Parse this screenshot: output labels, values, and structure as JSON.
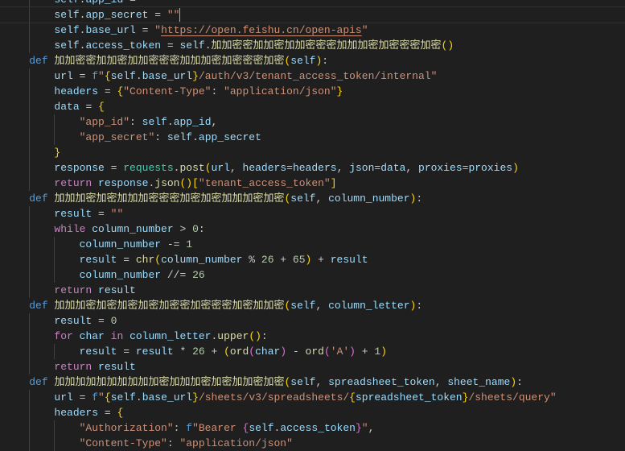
{
  "editor": {
    "language": "python",
    "theme_colors": {
      "background": "#1f1f1f",
      "variable": "#9cdcfe",
      "keyword": "#569cd6",
      "function": "#dcdcaa",
      "string": "#ce9178",
      "control": "#c586c0",
      "number": "#b5cea8",
      "bracket1": "#ffd700",
      "bracket2": "#da70d6",
      "module": "#4ec9b0"
    },
    "current_line": 1,
    "lines": [
      {
        "indent": 2,
        "tokens": [
          [
            "        ",
            "o"
          ],
          [
            "self",
            "v"
          ],
          [
            ".",
            "o"
          ],
          [
            "app_id",
            "v"
          ],
          [
            " = ",
            "o"
          ],
          [
            "\"\"",
            "s"
          ]
        ]
      },
      {
        "indent": 2,
        "tokens": [
          [
            "        ",
            "o"
          ],
          [
            "self",
            "v"
          ],
          [
            ".",
            "o"
          ],
          [
            "app_secret",
            "v"
          ],
          [
            " = ",
            "o"
          ],
          [
            "\"\"",
            "s"
          ]
        ]
      },
      {
        "indent": 2,
        "tokens": [
          [
            "        ",
            "o"
          ],
          [
            "self",
            "v"
          ],
          [
            ".",
            "o"
          ],
          [
            "base_url",
            "v"
          ],
          [
            " = ",
            "o"
          ],
          [
            "\"",
            "s"
          ],
          [
            "https://open.feishu.cn/open-apis",
            "u"
          ],
          [
            "\"",
            "s"
          ]
        ]
      },
      {
        "indent": 2,
        "tokens": [
          [
            "        ",
            "o"
          ],
          [
            "self",
            "v"
          ],
          [
            ".",
            "o"
          ],
          [
            "access_token",
            "v"
          ],
          [
            " = ",
            "o"
          ],
          [
            "self",
            "v"
          ],
          [
            ".",
            "o"
          ],
          [
            "加加密密加加密加加密密密加加加密加密密密加密",
            "f"
          ],
          [
            "()",
            "b1"
          ]
        ]
      },
      {
        "indent": 1,
        "tokens": [
          [
            "    ",
            "o"
          ],
          [
            "def ",
            "k"
          ],
          [
            "加加密密加加密加加密密密加加加密加密密密加密",
            "f"
          ],
          [
            "(",
            "b1"
          ],
          [
            "self",
            "v"
          ],
          [
            ")",
            "b1"
          ],
          [
            ":",
            "o"
          ]
        ]
      },
      {
        "indent": 2,
        "tokens": [
          [
            "        ",
            "o"
          ],
          [
            "url",
            "v"
          ],
          [
            " = ",
            "o"
          ],
          [
            "f",
            "k"
          ],
          [
            "\"",
            "s"
          ],
          [
            "{",
            "b1"
          ],
          [
            "self",
            "v"
          ],
          [
            ".",
            "o"
          ],
          [
            "base_url",
            "v"
          ],
          [
            "}",
            "b1"
          ],
          [
            "/auth/v3/tenant_access_token/internal\"",
            "s"
          ]
        ]
      },
      {
        "indent": 2,
        "tokens": [
          [
            "        ",
            "o"
          ],
          [
            "headers",
            "v"
          ],
          [
            " = ",
            "o"
          ],
          [
            "{",
            "b1"
          ],
          [
            "\"Content-Type\"",
            "s"
          ],
          [
            ": ",
            "o"
          ],
          [
            "\"application/json\"",
            "s"
          ],
          [
            "}",
            "b1"
          ]
        ]
      },
      {
        "indent": 2,
        "tokens": [
          [
            "        ",
            "o"
          ],
          [
            "data",
            "v"
          ],
          [
            " = ",
            "o"
          ],
          [
            "{",
            "b1"
          ]
        ]
      },
      {
        "indent": 3,
        "tokens": [
          [
            "            ",
            "o"
          ],
          [
            "\"app_id\"",
            "s"
          ],
          [
            ": ",
            "o"
          ],
          [
            "self",
            "v"
          ],
          [
            ".",
            "o"
          ],
          [
            "app_id",
            "v"
          ],
          [
            ",",
            "o"
          ]
        ]
      },
      {
        "indent": 3,
        "tokens": [
          [
            "            ",
            "o"
          ],
          [
            "\"app_secret\"",
            "s"
          ],
          [
            ": ",
            "o"
          ],
          [
            "self",
            "v"
          ],
          [
            ".",
            "o"
          ],
          [
            "app_secret",
            "v"
          ]
        ]
      },
      {
        "indent": 2,
        "tokens": [
          [
            "        ",
            "o"
          ],
          [
            "}",
            "b1"
          ]
        ]
      },
      {
        "indent": 2,
        "tokens": [
          [
            "        ",
            "o"
          ],
          [
            "response",
            "v"
          ],
          [
            " = ",
            "o"
          ],
          [
            "requests",
            "m"
          ],
          [
            ".",
            "o"
          ],
          [
            "post",
            "f"
          ],
          [
            "(",
            "b1"
          ],
          [
            "url",
            "v"
          ],
          [
            ", ",
            "o"
          ],
          [
            "headers",
            "v"
          ],
          [
            "=",
            "o"
          ],
          [
            "headers",
            "v"
          ],
          [
            ", ",
            "o"
          ],
          [
            "json",
            "v"
          ],
          [
            "=",
            "o"
          ],
          [
            "data",
            "v"
          ],
          [
            ", ",
            "o"
          ],
          [
            "proxies",
            "v"
          ],
          [
            "=",
            "o"
          ],
          [
            "proxies",
            "v"
          ],
          [
            ")",
            "b1"
          ]
        ]
      },
      {
        "indent": 2,
        "tokens": [
          [
            "        ",
            "o"
          ],
          [
            "return ",
            "c"
          ],
          [
            "response",
            "v"
          ],
          [
            ".",
            "o"
          ],
          [
            "json",
            "f"
          ],
          [
            "()",
            "b1"
          ],
          [
            "[",
            "b1"
          ],
          [
            "\"tenant_access_token\"",
            "s"
          ],
          [
            "]",
            "b1"
          ]
        ]
      },
      {
        "indent": 1,
        "tokens": [
          [
            "    ",
            "o"
          ],
          [
            "def ",
            "k"
          ],
          [
            "加加加密加密加加加密密密加密加密加加加密加密",
            "f"
          ],
          [
            "(",
            "b1"
          ],
          [
            "self",
            "v"
          ],
          [
            ", ",
            "o"
          ],
          [
            "column_number",
            "v"
          ],
          [
            ")",
            "b1"
          ],
          [
            ":",
            "o"
          ]
        ]
      },
      {
        "indent": 2,
        "tokens": [
          [
            "        ",
            "o"
          ],
          [
            "result",
            "v"
          ],
          [
            " = ",
            "o"
          ],
          [
            "\"\"",
            "s"
          ]
        ]
      },
      {
        "indent": 2,
        "tokens": [
          [
            "        ",
            "o"
          ],
          [
            "while ",
            "c"
          ],
          [
            "column_number",
            "v"
          ],
          [
            " > ",
            "o"
          ],
          [
            "0",
            "n"
          ],
          [
            ":",
            "o"
          ]
        ]
      },
      {
        "indent": 3,
        "tokens": [
          [
            "            ",
            "o"
          ],
          [
            "column_number",
            "v"
          ],
          [
            " -= ",
            "o"
          ],
          [
            "1",
            "n"
          ]
        ]
      },
      {
        "indent": 3,
        "tokens": [
          [
            "            ",
            "o"
          ],
          [
            "result",
            "v"
          ],
          [
            " = ",
            "o"
          ],
          [
            "chr",
            "f"
          ],
          [
            "(",
            "b1"
          ],
          [
            "column_number",
            "v"
          ],
          [
            " % ",
            "o"
          ],
          [
            "26",
            "n"
          ],
          [
            " + ",
            "o"
          ],
          [
            "65",
            "n"
          ],
          [
            ")",
            "b1"
          ],
          [
            " + ",
            "o"
          ],
          [
            "result",
            "v"
          ]
        ]
      },
      {
        "indent": 3,
        "tokens": [
          [
            "            ",
            "o"
          ],
          [
            "column_number",
            "v"
          ],
          [
            " //= ",
            "o"
          ],
          [
            "26",
            "n"
          ]
        ]
      },
      {
        "indent": 2,
        "tokens": [
          [
            "        ",
            "o"
          ],
          [
            "return ",
            "c"
          ],
          [
            "result",
            "v"
          ]
        ]
      },
      {
        "indent": 1,
        "tokens": [
          [
            "    ",
            "o"
          ],
          [
            "def ",
            "k"
          ],
          [
            "加加加密加密加密加密加密密加密密密加密加加密",
            "f"
          ],
          [
            "(",
            "b1"
          ],
          [
            "self",
            "v"
          ],
          [
            ", ",
            "o"
          ],
          [
            "column_letter",
            "v"
          ],
          [
            ")",
            "b1"
          ],
          [
            ":",
            "o"
          ]
        ]
      },
      {
        "indent": 2,
        "tokens": [
          [
            "        ",
            "o"
          ],
          [
            "result",
            "v"
          ],
          [
            " = ",
            "o"
          ],
          [
            "0",
            "n"
          ]
        ]
      },
      {
        "indent": 2,
        "tokens": [
          [
            "        ",
            "o"
          ],
          [
            "for ",
            "c"
          ],
          [
            "char ",
            "v"
          ],
          [
            "in ",
            "c"
          ],
          [
            "column_letter",
            "v"
          ],
          [
            ".",
            "o"
          ],
          [
            "upper",
            "f"
          ],
          [
            "()",
            "b1"
          ],
          [
            ":",
            "o"
          ]
        ]
      },
      {
        "indent": 3,
        "tokens": [
          [
            "            ",
            "o"
          ],
          [
            "result",
            "v"
          ],
          [
            " = ",
            "o"
          ],
          [
            "result",
            "v"
          ],
          [
            " * ",
            "o"
          ],
          [
            "26",
            "n"
          ],
          [
            " + ",
            "o"
          ],
          [
            "(",
            "b1"
          ],
          [
            "ord",
            "f"
          ],
          [
            "(",
            "b2"
          ],
          [
            "char",
            "v"
          ],
          [
            ")",
            "b2"
          ],
          [
            " - ",
            "o"
          ],
          [
            "ord",
            "f"
          ],
          [
            "(",
            "b2"
          ],
          [
            "'A'",
            "s"
          ],
          [
            ")",
            "b2"
          ],
          [
            " + ",
            "o"
          ],
          [
            "1",
            "n"
          ],
          [
            ")",
            "b1"
          ]
        ]
      },
      {
        "indent": 2,
        "tokens": [
          [
            "        ",
            "o"
          ],
          [
            "return ",
            "c"
          ],
          [
            "result",
            "v"
          ]
        ]
      },
      {
        "indent": 1,
        "tokens": [
          [
            "    ",
            "o"
          ],
          [
            "def ",
            "k"
          ],
          [
            "加加加加加加加加加加密加加加密加密加加密加密",
            "f"
          ],
          [
            "(",
            "b1"
          ],
          [
            "self",
            "v"
          ],
          [
            ", ",
            "o"
          ],
          [
            "spreadsheet_token",
            "v"
          ],
          [
            ", ",
            "o"
          ],
          [
            "sheet_name",
            "v"
          ],
          [
            ")",
            "b1"
          ],
          [
            ":",
            "o"
          ]
        ]
      },
      {
        "indent": 2,
        "tokens": [
          [
            "        ",
            "o"
          ],
          [
            "url",
            "v"
          ],
          [
            " = ",
            "o"
          ],
          [
            "f",
            "k"
          ],
          [
            "\"",
            "s"
          ],
          [
            "{",
            "b1"
          ],
          [
            "self",
            "v"
          ],
          [
            ".",
            "o"
          ],
          [
            "base_url",
            "v"
          ],
          [
            "}",
            "b1"
          ],
          [
            "/sheets/v3/spreadsheets/",
            "s"
          ],
          [
            "{",
            "b1"
          ],
          [
            "spreadsheet_token",
            "v"
          ],
          [
            "}",
            "b1"
          ],
          [
            "/sheets/query\"",
            "s"
          ]
        ]
      },
      {
        "indent": 2,
        "tokens": [
          [
            "        ",
            "o"
          ],
          [
            "headers",
            "v"
          ],
          [
            " = ",
            "o"
          ],
          [
            "{",
            "b1"
          ]
        ]
      },
      {
        "indent": 3,
        "tokens": [
          [
            "            ",
            "o"
          ],
          [
            "\"Authorization\"",
            "s"
          ],
          [
            ": ",
            "o"
          ],
          [
            "f",
            "k"
          ],
          [
            "\"Bearer ",
            "s"
          ],
          [
            "{",
            "b2"
          ],
          [
            "self",
            "v"
          ],
          [
            ".",
            "o"
          ],
          [
            "access_token",
            "v"
          ],
          [
            "}",
            "b2"
          ],
          [
            "\"",
            "s"
          ],
          [
            ",",
            "o"
          ]
        ]
      },
      {
        "indent": 3,
        "tokens": [
          [
            "            ",
            "o"
          ],
          [
            "\"Content-Type\"",
            "s"
          ],
          [
            ": ",
            "o"
          ],
          [
            "\"application/json\"",
            "s"
          ]
        ]
      }
    ]
  }
}
